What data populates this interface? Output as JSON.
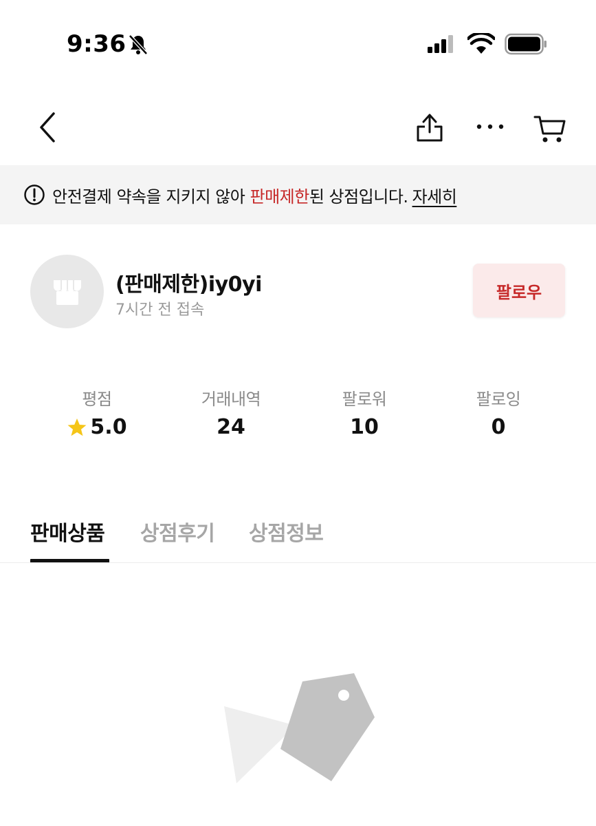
{
  "status_bar": {
    "time": "9:36"
  },
  "banner": {
    "text_before": "안전결제 약속을 지키지 않아 ",
    "text_highlight": "판매제한",
    "text_after": "된 상점입니다.",
    "link": "자세히",
    "highlight_color": "#c62828"
  },
  "profile": {
    "name": "(판매제한)iy0yi",
    "last_seen": "7시간 전 접속",
    "follow_label": "팔로우"
  },
  "stats": [
    {
      "label": "평점",
      "value": "5.0",
      "icon": "star-icon"
    },
    {
      "label": "거래내역",
      "value": "24"
    },
    {
      "label": "팔로워",
      "value": "10"
    },
    {
      "label": "팔로잉",
      "value": "0"
    }
  ],
  "tabs": [
    {
      "label": "판매상품",
      "active": true
    },
    {
      "label": "상점후기",
      "active": false
    },
    {
      "label": "상점정보",
      "active": false
    }
  ],
  "colors": {
    "accent_red": "#c62828",
    "banner_bg": "#f4f4f4",
    "star": "#f5c518"
  }
}
